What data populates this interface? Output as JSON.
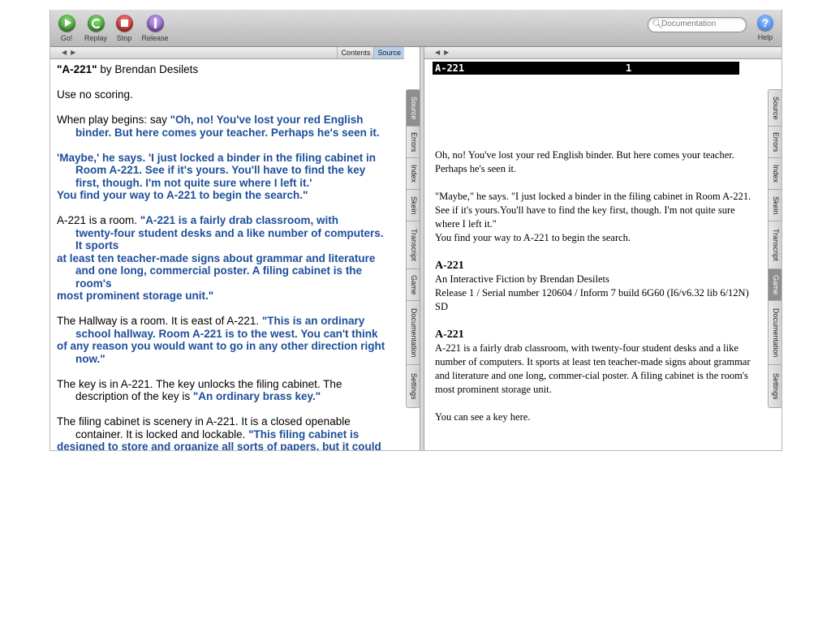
{
  "toolbar": {
    "go": "Go!",
    "replay": "Replay",
    "stop": "Stop",
    "release": "Release",
    "search_placeholder": "Documentation",
    "help": "Help"
  },
  "left_pane": {
    "tabs": [
      "Contents",
      "Source"
    ],
    "active_tab": "Source",
    "side_tabs": [
      "Source",
      "Errors",
      "Index",
      "Skein",
      "Transcript",
      "Game",
      "Documentation",
      "Settings"
    ],
    "active_side_tab": "Source"
  },
  "source": [
    [
      [
        "b",
        "\"A-221\""
      ],
      [
        "n",
        " by Brendan Desilets"
      ]
    ],
    "Use no scoring.",
    [
      [
        "n",
        "When play begins: say "
      ],
      [
        "q",
        "\"Oh, no! You've lost your red English"
      ]
    ],
    [
      [
        "q",
        "binder. But here comes your teacher.  Perhaps he's seen it."
      ]
    ],
    [
      [
        "q",
        "'Maybe,' he says.  'I just locked a binder in the filing cabinet in"
      ]
    ],
    [
      [
        "q",
        "Room A-221.  See if it's yours. You'll have to find the key"
      ]
    ],
    [
      [
        "q",
        "first, though. I'm not quite sure where I left it.'"
      ]
    ],
    [
      [
        "q",
        "You find your way to A-221 to begin the search.\""
      ]
    ],
    [
      [
        "n",
        " A-221 is a room.  "
      ],
      [
        "q",
        "\"A-221 is a fairly drab classroom, with"
      ]
    ],
    [
      [
        "q",
        "twenty-four student desks and a like number of computers."
      ]
    ],
    [
      [
        "q",
        "It sports"
      ]
    ],
    [
      [
        "q",
        "at least ten teacher-made signs about grammar and literature"
      ]
    ],
    [
      [
        "q",
        "and one long, commercial poster.  A filing cabinet is the"
      ]
    ],
    [
      [
        "q",
        "room's"
      ]
    ],
    [
      [
        "q",
        "most prominent storage unit.\""
      ]
    ],
    [
      [
        "n",
        "The Hallway is a room.  It is east of A-221.  "
      ],
      [
        "q",
        "\"This is an ordinary"
      ]
    ],
    [
      [
        "q",
        "school hallway.  Room A-221 is to the west.  You can't think"
      ]
    ],
    [
      [
        "q",
        "of any reason you would want to go in any other direction right"
      ]
    ],
    [
      [
        "q",
        "now.\""
      ]
    ],
    "The key is in A-221. The key unlocks the filing cabinet. The",
    [
      [
        "n",
        "description of the key is "
      ],
      [
        "q",
        "\"An ordinary brass key.\""
      ]
    ],
    "The filing cabinet is scenery in A-221.  It is a closed openable",
    [
      [
        "n",
        "container.  It is locked and lockable. "
      ],
      [
        "q",
        "\"This filing cabinet is"
      ]
    ],
    [
      [
        "q",
        "designed to store and organize all sorts of papers, but it could"
      ]
    ]
  ],
  "right_pane": {
    "side_tabs": [
      "Source",
      "Errors",
      "Index",
      "Skein",
      "Transcript",
      "Game",
      "Documentation",
      "Settings"
    ],
    "active_side_tab": "Game",
    "status_location": "A-221",
    "status_score": "1"
  },
  "game_text": {
    "intro1": "Oh, no! You've lost your red English binder. But here comes your teacher.  Perhaps he's seen it.",
    "intro2": "\"Maybe,\" he says.  \"I just locked a binder in the filing cabinet in Room A-221.  See if it's yours.You'll have to find the key first, though. I'm not quite sure where I left it.\"",
    "intro3": " You find your way to A-221 to begin the search.",
    "banner_title": "A-221",
    "banner_line1": "An Interactive Fiction by Brendan Desilets",
    "banner_line2": "Release 1 / Serial number 120604 / Inform 7 build 6G60 (I6/v6.32 lib 6/12N) SD",
    "room_title": "A-221",
    "room_desc": "A-221 is a fairly drab classroom, with twenty-four student desks and a like number of computers. It sports at least ten teacher-made signs about grammar and literature and one long, commer-cial poster.  A filing cabinet is the room's most prominent storage unit.",
    "key_line": "You can see a key here."
  }
}
